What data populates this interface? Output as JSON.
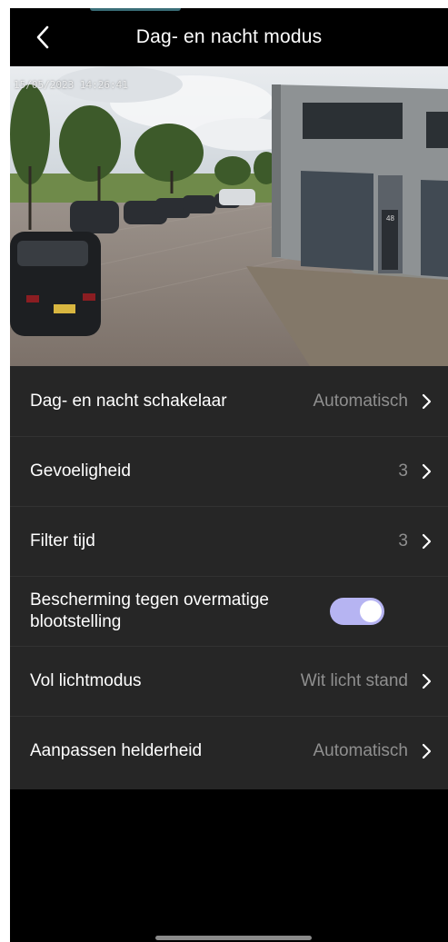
{
  "header": {
    "title": "Dag- en nacht modus",
    "back_icon": "chevron-left-icon"
  },
  "camera": {
    "timestamp": "15/05/2023 14:26:41",
    "building_number": "48"
  },
  "settings": {
    "day_night_switch": {
      "label": "Dag- en nacht schakelaar",
      "value": "Automatisch"
    },
    "sensitivity": {
      "label": "Gevoeligheid",
      "value": "3"
    },
    "filter_time": {
      "label": "Filter tijd",
      "value": "3"
    },
    "overexposure_protection": {
      "label": "Bescherming tegen overmatige blootstelling",
      "enabled": true
    },
    "full_light_mode": {
      "label": "Vol lichtmodus",
      "value": "Wit licht stand"
    },
    "brightness_adjust": {
      "label": "Aanpassen helderheid",
      "value": "Automatisch"
    }
  },
  "colors": {
    "background": "#000000",
    "panel": "#262626",
    "toggle_on": "#b6b4f2",
    "value_text": "#8f8f8f"
  }
}
